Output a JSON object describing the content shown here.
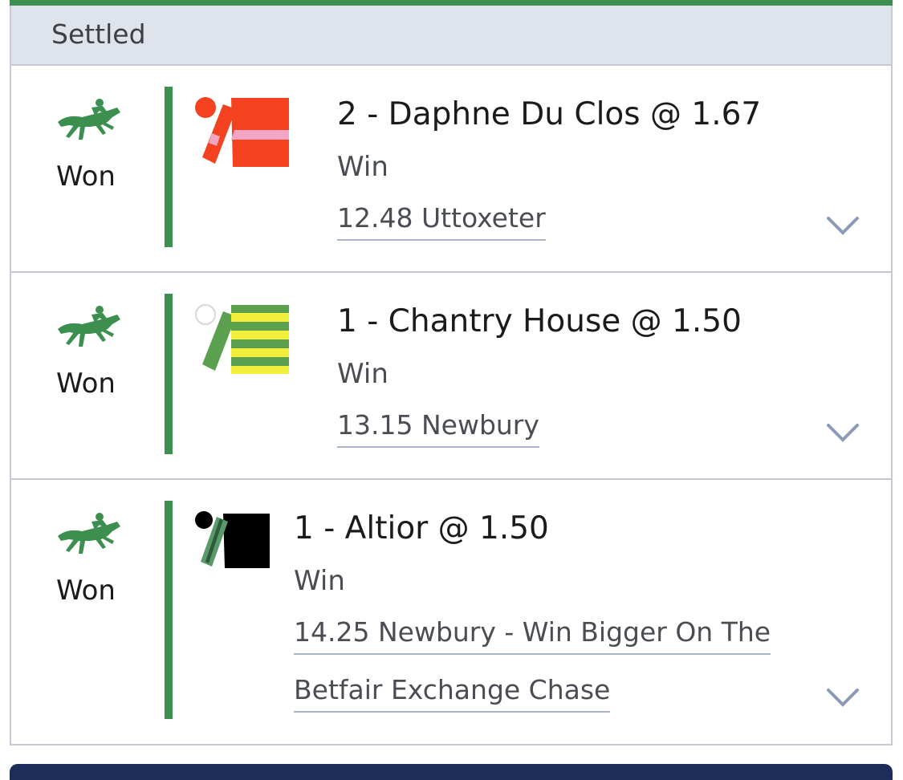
{
  "section": {
    "title": "Settled"
  },
  "colors": {
    "accent_green": "#3c8f4f",
    "header_bg": "#dfe3ec",
    "navy": "#1d2d5a"
  },
  "bets": [
    {
      "status": "Won",
      "status_icon": "horse-racing-icon",
      "selection": "2 - Daphne Du Clos @ 1.67",
      "market": "Win",
      "event_lines": [
        "12.48 Uttoxeter"
      ],
      "silk": "red-silk-pink-band-icon"
    },
    {
      "status": "Won",
      "status_icon": "horse-racing-icon",
      "selection": "1 - Chantry House @ 1.50",
      "market": "Win",
      "event_lines": [
        "13.15 Newbury"
      ],
      "silk": "yellow-green-hoops-silk-icon"
    },
    {
      "status": "Won",
      "status_icon": "horse-racing-icon",
      "selection": "1 - Altior @ 1.50",
      "market": "Win",
      "event_lines": [
        "14.25 Newbury - Win Bigger On The",
        "Betfair Exchange Chase"
      ],
      "silk": "black-silk-green-sleeve-icon"
    }
  ]
}
